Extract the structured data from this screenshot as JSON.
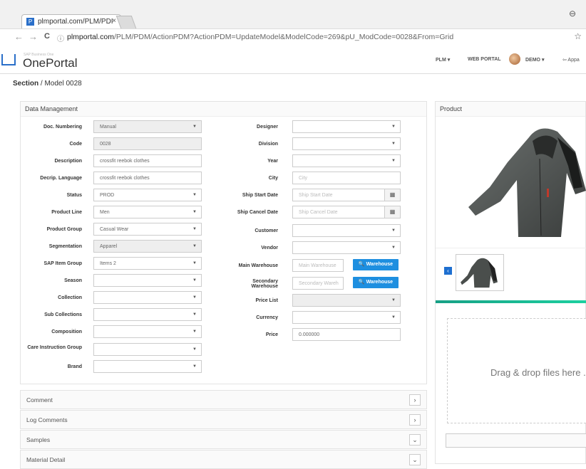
{
  "browser": {
    "tab_title": "plmportal.com/PLM/PDI",
    "tab_close": "×",
    "favicon": "P",
    "url_host": "plmportal.com",
    "url_path": "/PLM/PDM/ActionPDM?ActionPDM=UpdateModel&ModelCode=269&pU_ModCode=0028&From=Grid",
    "back": "←",
    "forward": "→",
    "reload": "C",
    "info": "ⓘ",
    "star": "☆",
    "profile": "⊖"
  },
  "header": {
    "logo_small": "SAP Business One",
    "logo": "OnePortal",
    "plm": "PLM ▾",
    "web_portal": "WEB PORTAL",
    "user": "DEMO ▾",
    "appa": "⇦ Appa"
  },
  "breadcrumb": {
    "section": "Section",
    "sep": " / ",
    "model": "Model 0028"
  },
  "data_management": {
    "title": "Data Management",
    "left": [
      {
        "label": "Doc. Numbering",
        "value": "Manual",
        "type": "select",
        "grey": true
      },
      {
        "label": "Code",
        "value": "0028",
        "type": "text",
        "grey": true
      },
      {
        "label": "Description",
        "value": "crossfit reebok clothes",
        "type": "text"
      },
      {
        "label": "Decrip. Language",
        "value": "crossfit reebok clothes",
        "type": "text"
      },
      {
        "label": "Status",
        "value": "PROD",
        "type": "select"
      },
      {
        "label": "Product Line",
        "value": "Men",
        "type": "select"
      },
      {
        "label": "Product Group",
        "value": "Casual Wear",
        "type": "select"
      },
      {
        "label": "Segmentation",
        "value": "Apparel",
        "type": "select",
        "grey": true
      },
      {
        "label": "SAP Item Group",
        "value": "Items 2",
        "type": "select"
      },
      {
        "label": "Season",
        "value": "",
        "type": "select"
      },
      {
        "label": "Collection",
        "value": "",
        "type": "select"
      },
      {
        "label": "Sub Collections",
        "value": "",
        "type": "select"
      },
      {
        "label": "Composition",
        "value": "",
        "type": "select"
      },
      {
        "label": "Care Instruction Group",
        "value": "",
        "type": "select"
      },
      {
        "label": "Brand",
        "value": "",
        "type": "select"
      }
    ],
    "right": {
      "designer": "Designer",
      "division": "Division",
      "year": "Year",
      "city": "City",
      "city_ph": "City",
      "ship_start": "Ship Start Date",
      "ship_start_ph": "Ship Start Date",
      "ship_cancel": "Ship Cancel Date",
      "ship_cancel_ph": "Ship Cancel Date",
      "customer": "Customer",
      "vendor": "Vendor",
      "main_wh": "Main Warehouse",
      "main_wh_ph": "Main Warehouse",
      "sec_wh_1": "Secondary",
      "sec_wh_2": "Warehouse",
      "sec_wh_ph": "Secondary Wareh",
      "wh_button": "🔍 Warehouse",
      "price_list": "Price List",
      "currency": "Currency",
      "price": "Price",
      "price_value": "0.000000"
    }
  },
  "accordions": [
    {
      "label": "Comment",
      "arrow": "›"
    },
    {
      "label": "Log Comments",
      "arrow": "›"
    },
    {
      "label": "Samples",
      "arrow": "⌄"
    },
    {
      "label": "Material Detail",
      "arrow": "⌄"
    }
  ],
  "product": {
    "title": "Product",
    "thumb_prev": "‹",
    "drop_text": "Drag & drop files here ..."
  },
  "caret": "▼",
  "cal": "▦"
}
